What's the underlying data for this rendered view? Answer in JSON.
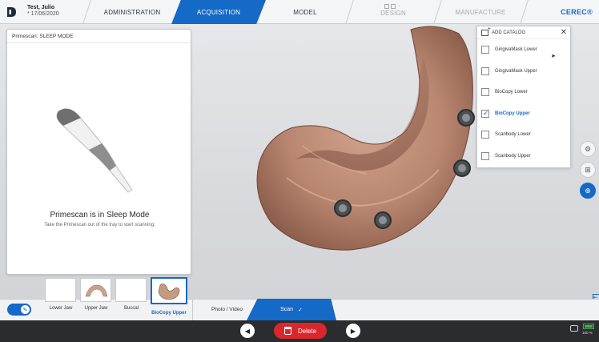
{
  "header": {
    "patient_name": "Test, Julio",
    "patient_dob": "* 17/06/2020",
    "steps": {
      "administration": "ADMINISTRATION",
      "acquisition": "ACQUISITION",
      "model": "MODEL",
      "design": "DESIGN",
      "manufacture": "MANUFACTURE"
    },
    "brand": "CEREC®",
    "active_step": "ACQUISITION",
    "accent_color": "#1569c7"
  },
  "sleep_panel": {
    "header": "Primescan: SLEEP MODE",
    "title": "Primescan is in Sleep Mode",
    "subtitle": "Take the Primescan out of the tray to start scanning."
  },
  "catalog": {
    "title": "ADD CATALOG",
    "items": [
      {
        "label": "GingivaMask Lower",
        "checked": false
      },
      {
        "label": "GingivaMask Upper",
        "checked": false
      },
      {
        "label": "BioCopy Lower",
        "checked": false
      },
      {
        "label": "BioCopy Upper",
        "checked": true
      },
      {
        "label": "Scanbody Lower",
        "checked": false
      },
      {
        "label": "Scanbody Upper",
        "checked": false
      }
    ]
  },
  "thumbnails": [
    {
      "label": "Lower Jaw",
      "has_image": false,
      "selected": false
    },
    {
      "label": "Upper Jaw",
      "has_image": true,
      "selected": false
    },
    {
      "label": "Buccal",
      "has_image": false,
      "selected": false
    },
    {
      "label": "BioCopy Upper",
      "has_image": true,
      "selected": true
    }
  ],
  "bottom_tabs": {
    "photo_video": "Photo / Video",
    "scan": "Scan"
  },
  "footer": {
    "delete_label": "Delete",
    "battery": "100 %"
  }
}
